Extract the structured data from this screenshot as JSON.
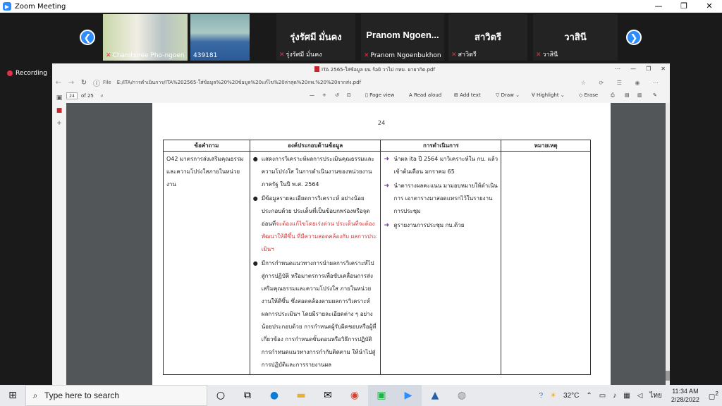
{
  "zoom": {
    "title": "Zoom Meeting",
    "win_controls": [
      "—",
      "❐",
      "✕"
    ],
    "recording": "Recording"
  },
  "participants": [
    {
      "name": "Chanitsiree Pho-ngoen",
      "type": "video"
    },
    {
      "name": "439181",
      "type": "video"
    },
    {
      "big": "รุ่งรัศมี มั่นคง",
      "name": "รุ่งรัศมี มั่นคง",
      "type": "avatar"
    },
    {
      "big": "Pranom  Ngoen...",
      "name": "Pranom Ngoenbukhon",
      "type": "avatar"
    },
    {
      "big": "สาวิตรี",
      "name": "สาวิตรี",
      "type": "avatar"
    },
    {
      "big": "วาสินี",
      "name": "วาสินี",
      "type": "avatar"
    }
  ],
  "browser": {
    "title": "ITA 2565-ใส่ข้อมูล ยน ร้อยิ วาไม่ กทม. ผายากิต.pdf",
    "file_label": "File",
    "url": "E:/ITA/การดำเนินการ/ITA%202565-ใส่ข้อมูล%20%20ข้อมูล%20แก้ไข%20ล่าสุด%20กพ.%20%20จากส่ง.pdf"
  },
  "pdf_toolbar": {
    "page": "24",
    "of": "of 25",
    "page_view": "Page view",
    "read_aloud": "Read aloud",
    "add_text": "Add text",
    "draw": "Draw",
    "highlight": "Highlight",
    "erase": "Erase"
  },
  "document": {
    "page_number": "24",
    "headers": [
      "ข้อคำถาม",
      "องค์ประกอบด้านข้อมูล",
      "การดำเนินการ",
      "หมายเหตุ"
    ],
    "question": "O42 มาตรการส่งเสริมคุณธรรมและความโปร่งใสภายในหน่วยงาน",
    "components": [
      {
        "text": "แสดงการวิเคราะห์ผลการประเมินคุณธรรมและความโปร่งใส ในการดำเนินงานของหน่วยงานภาครัฐ ในปี พ.ศ. 2564"
      },
      {
        "text": "มีข้อมูลรายละเอียดการวิเคราะห์ อย่างน้อยประกอบด้วย ประเด็นที่เป็นข้อบกพร่องหรือจุดอ่อนที่",
        "red": "จะต้องแก้ไขโดยเร่งด่วน ประเด็นที่จะต้องพัฒนาให้ดีขึ้น ที่มีความสอดคล้องกับ ผลการประเมินฯ"
      },
      {
        "text": "มีการกำหนดแนวทางการนำผลการวิเคราะห์ไปสู่การปฏิบัติ หรือมาตรการเพื่อขับเคลื่อนการส่งเสริมคุณธรรมและความโปร่งใส ภายในหน่วยงานให้ดีขึ้น ซึ่งสอดคล้องตามผลการวิเคราะห์ ผลการประเมินฯ โดยมีรายละเอียดต่าง ๆ อย่างน้อยประกอบด้วย การกำหนดผู้รับผิดชอบหรือผู้ที่เกี่ยวข้อง การกำหนดขั้นตอนหรือวิธีการปฏิบัติ การกำหนดแนวทางการกำกับติดตาม ให้นำไปสู่การปฏิบัติและการรายงานผล"
      }
    ],
    "actions": [
      "นำผล ita ปี 2564 มาวิเคราะห์ใน กบ. แล้ว เข้าต้นเดือน มกราคม 65",
      "นำตารางผลคะแนน มามอบหมายให้ดำเนินการ เอาตารางมาสอดแทรกไว้ในรายงานการประชุม",
      "ดูรายงานการประชุม กบ.ด้วย"
    ],
    "remark": ""
  },
  "taskbar": {
    "search_placeholder": "Type here to search",
    "weather": "32°C",
    "lang": "ไทย",
    "time": "11:34 AM",
    "date": "2/28/2022",
    "notif_count": "2"
  }
}
